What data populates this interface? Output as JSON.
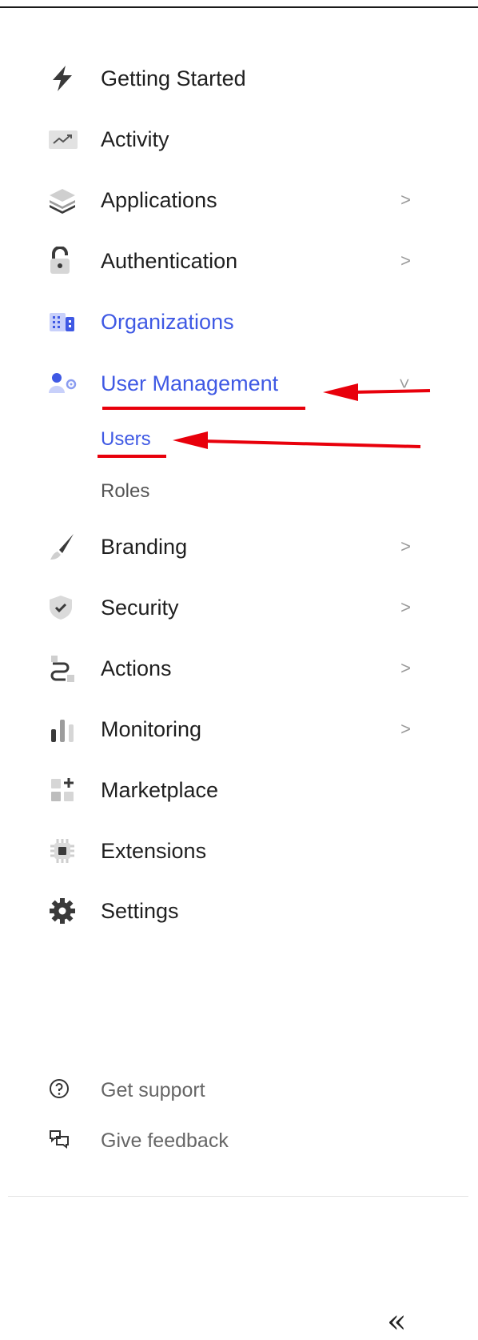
{
  "nav": {
    "items": [
      {
        "label": "Getting Started",
        "icon": "bolt-icon",
        "has_chevron": false,
        "active": false
      },
      {
        "label": "Activity",
        "icon": "activity-chart-icon",
        "has_chevron": false,
        "active": false
      },
      {
        "label": "Applications",
        "icon": "layers-icon",
        "has_chevron": true,
        "active": false
      },
      {
        "label": "Authentication",
        "icon": "lock-icon",
        "has_chevron": true,
        "active": false
      },
      {
        "label": "Organizations",
        "icon": "building-icon",
        "has_chevron": false,
        "active": true
      },
      {
        "label": "User Management",
        "icon": "user-gear-icon",
        "has_chevron": true,
        "active": true,
        "expanded": true,
        "subitems": [
          {
            "label": "Users",
            "active": true
          },
          {
            "label": "Roles",
            "active": false
          }
        ]
      },
      {
        "label": "Branding",
        "icon": "brush-icon",
        "has_chevron": true,
        "active": false
      },
      {
        "label": "Security",
        "icon": "shield-check-icon",
        "has_chevron": true,
        "active": false
      },
      {
        "label": "Actions",
        "icon": "flow-icon",
        "has_chevron": true,
        "active": false
      },
      {
        "label": "Monitoring",
        "icon": "bar-chart-icon",
        "has_chevron": true,
        "active": false
      },
      {
        "label": "Marketplace",
        "icon": "grid-plus-icon",
        "has_chevron": false,
        "active": false
      },
      {
        "label": "Extensions",
        "icon": "chip-icon",
        "has_chevron": false,
        "active": false
      },
      {
        "label": "Settings",
        "icon": "gear-icon",
        "has_chevron": false,
        "active": false
      }
    ]
  },
  "footer": {
    "support_label": "Get support",
    "feedback_label": "Give feedback",
    "collapse_glyph": "«"
  },
  "colors": {
    "accent": "#3f59e4",
    "annotation": "#e8000b",
    "icon_dark": "#3a3a3a",
    "icon_light": "#c9c9c9"
  }
}
